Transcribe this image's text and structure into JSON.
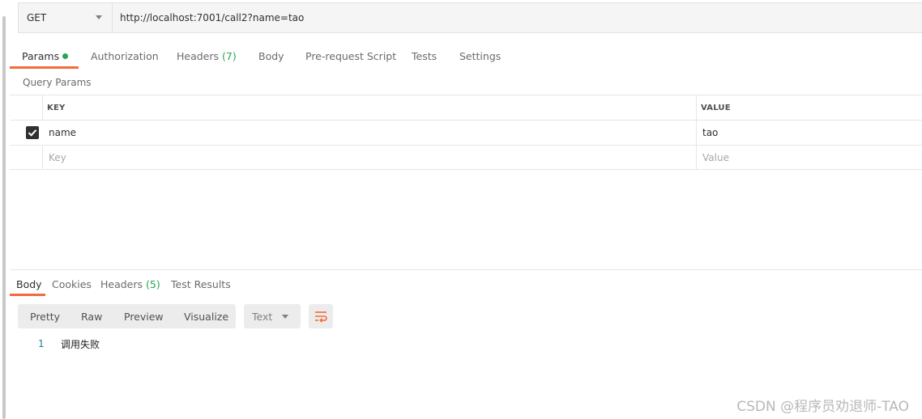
{
  "request": {
    "method": "GET",
    "url": "http://localhost:7001/call2?name=tao"
  },
  "request_tabs": {
    "params": "Params",
    "authorization": "Authorization",
    "headers": "Headers",
    "headers_count": "(7)",
    "body": "Body",
    "pre_request_script": "Pre-request Script",
    "tests": "Tests",
    "settings": "Settings"
  },
  "query_params": {
    "title": "Query Params",
    "columns": {
      "key": "KEY",
      "value": "VALUE"
    },
    "rows": [
      {
        "checked": true,
        "key": "name",
        "value": "tao"
      }
    ],
    "new_row": {
      "key_placeholder": "Key",
      "value_placeholder": "Value"
    }
  },
  "response_tabs": {
    "body": "Body",
    "cookies": "Cookies",
    "headers": "Headers",
    "headers_count": "(5)",
    "test_results": "Test Results"
  },
  "response_toolbar": {
    "views": [
      "Pretty",
      "Raw",
      "Preview",
      "Visualize"
    ],
    "format": "Text",
    "wrap_icon": "wrap-lines-icon"
  },
  "response_body": {
    "lines": [
      {
        "number": "1",
        "text": "调用失败"
      }
    ]
  },
  "watermark": "CSDN @程序员劝退师-TAO",
  "colors": {
    "accent": "#f26b3a",
    "active_dot": "#26a552",
    "count_green": "#26a552",
    "line_number": "#2b7a9b"
  }
}
